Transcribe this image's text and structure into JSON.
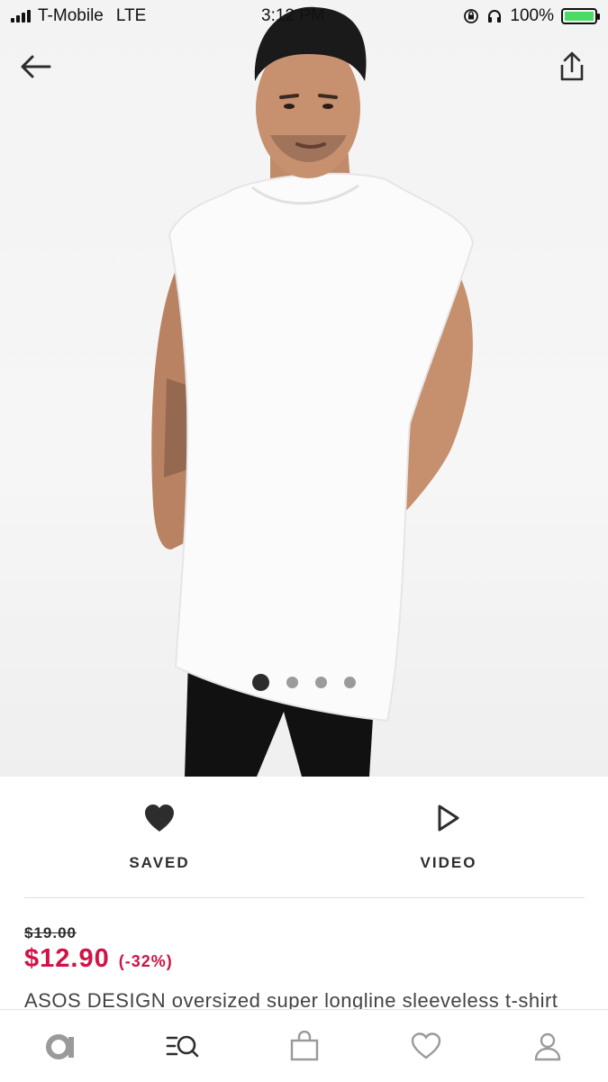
{
  "status_bar": {
    "carrier": "T-Mobile",
    "network": "LTE",
    "time": "3:12 PM",
    "battery": "100%",
    "battery_level": 1.0,
    "icons": [
      "signal-icon",
      "lock-rotation-icon",
      "headphones-icon",
      "battery-charging-icon"
    ]
  },
  "nav": {
    "back_icon": "arrow-left-icon",
    "share_icon": "share-icon"
  },
  "gallery": {
    "image_count": 4,
    "active_index": 0
  },
  "actions": {
    "saved_label": "SAVED",
    "saved_icon": "heart-filled-icon",
    "video_label": "VIDEO",
    "video_icon": "play-outline-icon"
  },
  "product": {
    "old_price": "$19.00",
    "price": "$12.90",
    "discount": "(-32%)",
    "title": "ASOS DESIGN oversized super longline sleeveless t-shirt"
  },
  "tabbar": {
    "items": [
      "home-icon",
      "search-icon",
      "bag-icon",
      "saved-heart-icon",
      "account-icon"
    ]
  },
  "colors": {
    "sale": "#d01345",
    "text": "#2d2d2d",
    "battery": "#4cd964"
  }
}
